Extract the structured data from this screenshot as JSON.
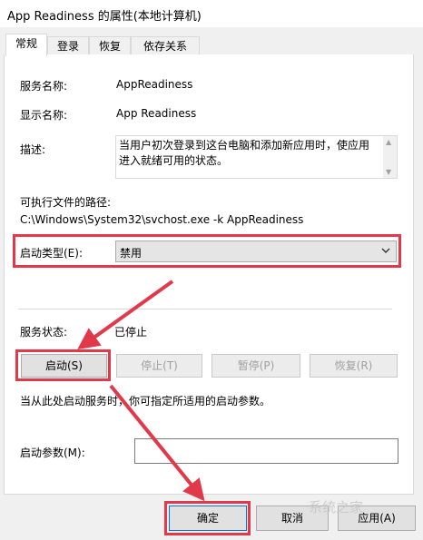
{
  "window": {
    "title": "App Readiness 的属性(本地计算机)"
  },
  "tabs": [
    {
      "label": "常规",
      "active": true
    },
    {
      "label": "登录"
    },
    {
      "label": "恢复"
    },
    {
      "label": "依存关系"
    }
  ],
  "general": {
    "service_name_label": "服务名称:",
    "service_name": "AppReadiness",
    "display_name_label": "显示名称:",
    "display_name": "App Readiness",
    "description_label": "描述:",
    "description": "当用户初次登录到这台电脑和添加新应用时，使应用进入就绪可用的状态。",
    "path_label": "可执行文件的路径:",
    "path": "C:\\Windows\\System32\\svchost.exe -k AppReadiness",
    "startup_type_label": "启动类型(E):",
    "startup_type": "禁用",
    "status_label": "服务状态:",
    "status": "已停止",
    "buttons": {
      "start": "启动(S)",
      "stop": "停止(T)",
      "pause": "暂停(P)",
      "resume": "恢复(R)"
    },
    "hint": "当从此处启动服务时，你可指定所适用的启动参数。",
    "params_label": "启动参数(M):",
    "params_value": ""
  },
  "footer": {
    "ok": "确定",
    "cancel": "取消",
    "apply": "应用(A)"
  },
  "watermark": "系统之家",
  "colors": {
    "highlight": "#e2394a",
    "panel": "#ffffff",
    "window": "#f0f0f0"
  },
  "icons": {
    "dropdown": "chevron-down-icon",
    "scroll_up": "scroll-up-icon",
    "scroll_down": "scroll-down-icon"
  }
}
